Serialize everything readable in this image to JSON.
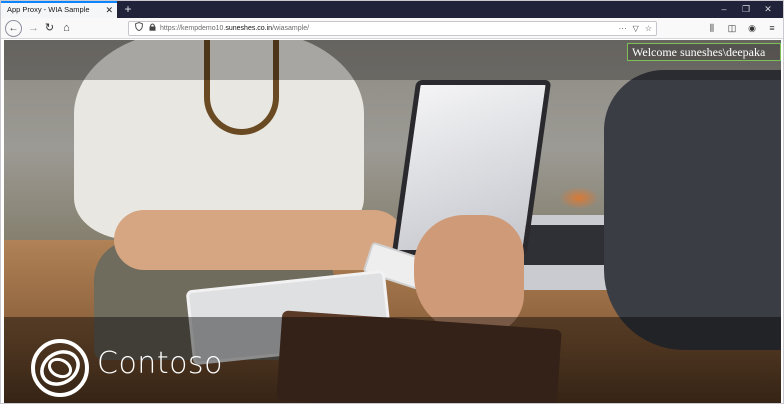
{
  "browser": {
    "tab": {
      "title": "App Proxy - WIA Sample",
      "close_glyph": "✕"
    },
    "new_tab_glyph": "+",
    "window_controls": {
      "minimize": "–",
      "restore": "❐",
      "close": "✕"
    },
    "nav": {
      "back": "←",
      "forward": "→",
      "reload": "↻",
      "home": "⌂"
    },
    "url": {
      "prefix": "https://",
      "host_pre": "kempdemo10.",
      "host_domain": "suneshes.co.in",
      "path": "/wiasample/",
      "shield_icon": "shield-icon",
      "lock_icon": "lock-icon",
      "more_glyph": "···",
      "pocket_glyph": "▽",
      "bookmark_glyph": "☆"
    },
    "toolbar": {
      "library": "⫼",
      "sidebar": "◫",
      "account": "◉",
      "menu": "≡"
    },
    "accent_color": "#0a84ff"
  },
  "page": {
    "welcome_text": "Welcome suneshes\\deepaka",
    "welcome_border_color": "#7fbf5a",
    "brand_name": "Contoso",
    "brand_logo_icon": "contoso-rings-logo"
  }
}
